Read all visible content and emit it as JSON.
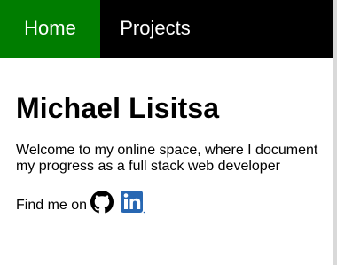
{
  "nav": {
    "items": [
      {
        "label": "Home",
        "active": true
      },
      {
        "label": "Projects",
        "active": false
      }
    ]
  },
  "main": {
    "title": "Michael Lisitsa",
    "intro": "Welcome to my online space, where I document my progress as a full stack web developer",
    "find_label": "Find me on",
    "links": [
      {
        "icon": "github-icon"
      },
      {
        "icon": "linkedin-icon"
      }
    ]
  },
  "colors": {
    "nav_bg": "#000000",
    "nav_active": "#007d00",
    "nav_text": "#ffffff",
    "linkedin": "#2867b2"
  }
}
